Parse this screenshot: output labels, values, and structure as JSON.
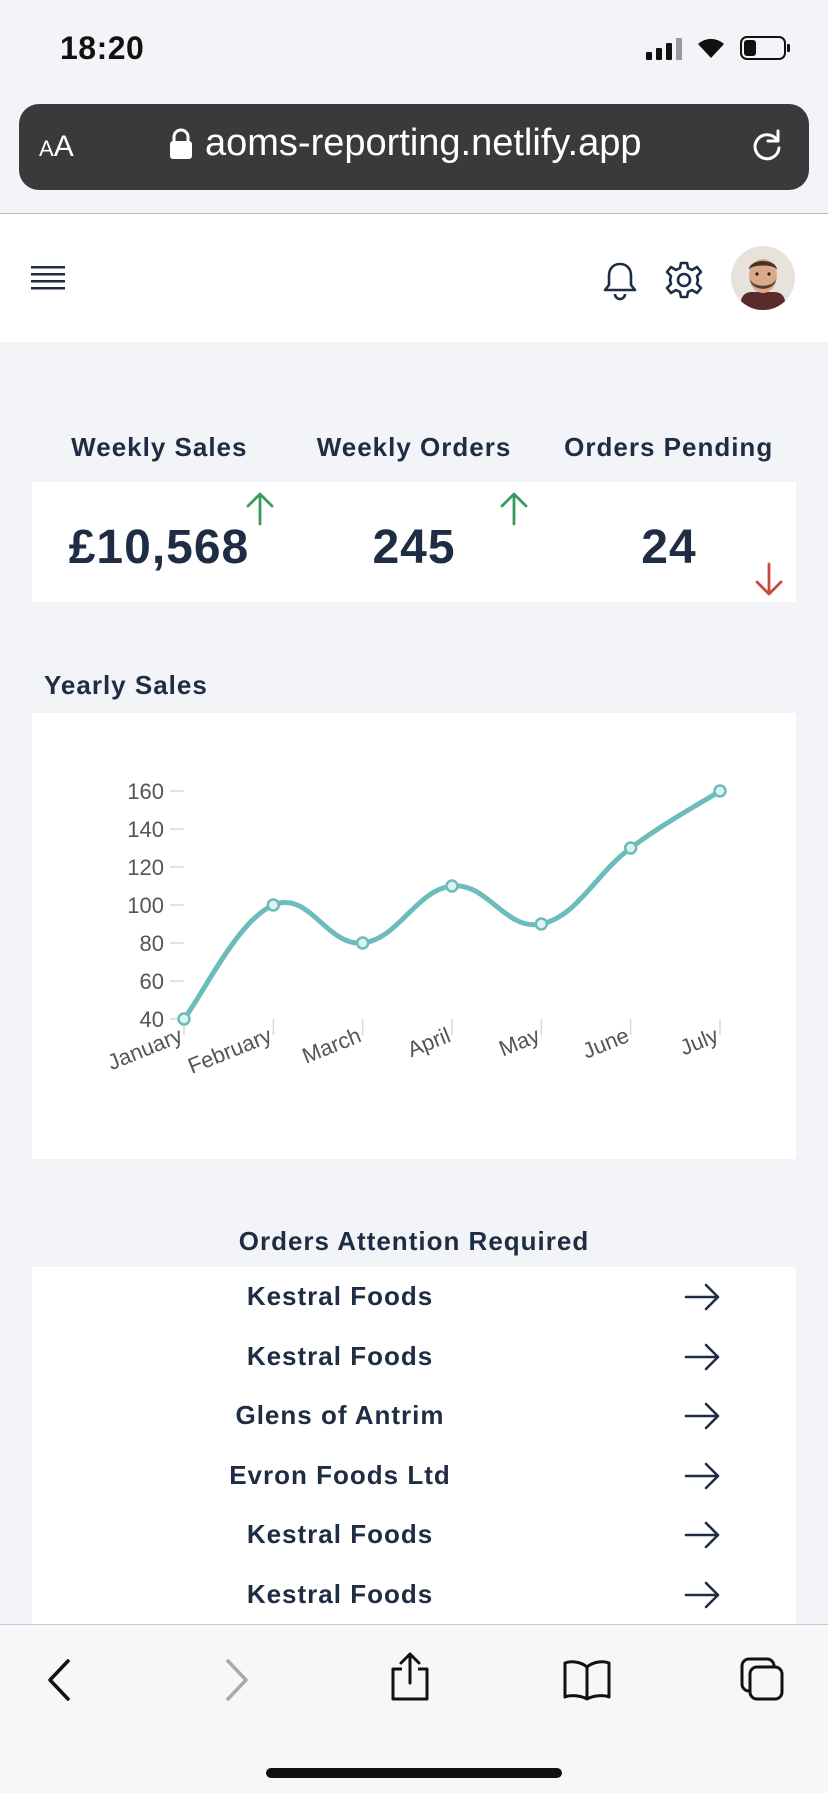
{
  "status": {
    "time": "18:20"
  },
  "browser": {
    "text_size_label": "AA",
    "url": "aoms-reporting.netlify.app"
  },
  "kpis": [
    {
      "label": "Weekly Sales",
      "value": "£10,568",
      "trend": "up",
      "trend_color": "#3d9a5f"
    },
    {
      "label": "Weekly Orders",
      "value": "245",
      "trend": "up",
      "trend_color": "#3d9a5f"
    },
    {
      "label": "Orders Pending",
      "value": "24",
      "trend": "down",
      "trend_color": "#c94a3e"
    }
  ],
  "yearly_sales": {
    "title": "Yearly Sales"
  },
  "chart_data": {
    "type": "line",
    "categories": [
      "January",
      "February",
      "March",
      "April",
      "May",
      "June",
      "July"
    ],
    "series": [
      {
        "values": [
          40,
          100,
          80,
          110,
          90,
          130,
          160
        ],
        "color": "#6cbdb9"
      }
    ],
    "yticks": [
      40,
      60,
      80,
      100,
      120,
      140,
      160
    ],
    "ylim": [
      40,
      160
    ],
    "title": "",
    "xlabel": "",
    "ylabel": "",
    "grid": false,
    "smooth": true
  },
  "orders_attention": {
    "title": "Orders Attention Required",
    "items": [
      {
        "name": "Kestral Foods"
      },
      {
        "name": "Kestral Foods"
      },
      {
        "name": "Glens of Antrim"
      },
      {
        "name": "Evron Foods Ltd"
      },
      {
        "name": "Kestral Foods"
      },
      {
        "name": "Kestral Foods"
      }
    ]
  },
  "colors": {
    "accent": "#6cbdb9",
    "text": "#1f2d44",
    "up": "#3d9a5f",
    "down": "#c94a3e"
  }
}
